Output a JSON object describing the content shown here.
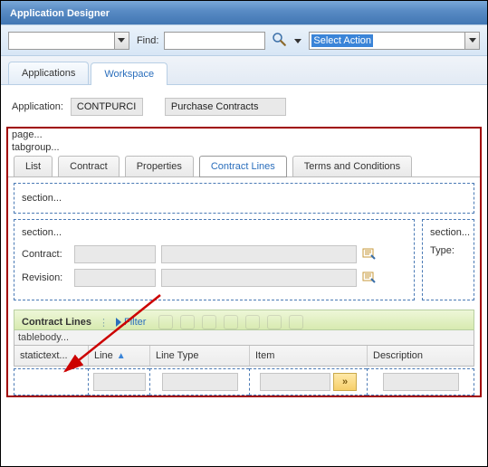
{
  "title": "Application Designer",
  "toolbar": {
    "find_label": "Find:",
    "find_value": "",
    "select_action": "Select Action"
  },
  "main_tabs": [
    {
      "label": "Applications"
    },
    {
      "label": "Workspace"
    }
  ],
  "application": {
    "label": "Application:",
    "code": "CONTPURCI",
    "desc": "Purchase Contracts"
  },
  "workspace": {
    "page_ph": "page...",
    "tabgroup_ph": "tabgroup...",
    "tabs": [
      {
        "label": "List"
      },
      {
        "label": "Contract"
      },
      {
        "label": "Properties"
      },
      {
        "label": "Contract Lines"
      },
      {
        "label": "Terms and Conditions"
      }
    ],
    "section_ph": "section...",
    "fields": {
      "contract_label": "Contract:",
      "revision_label": "Revision:",
      "type_label": "Type:"
    },
    "table": {
      "title": "Contract Lines",
      "filter_label": "Filter",
      "tablebody_ph": "tablebody...",
      "static_ph": "statictext...",
      "columns": {
        "line": "Line",
        "line_type": "Line Type",
        "item": "Item",
        "description": "Description"
      },
      "go": "»"
    }
  }
}
